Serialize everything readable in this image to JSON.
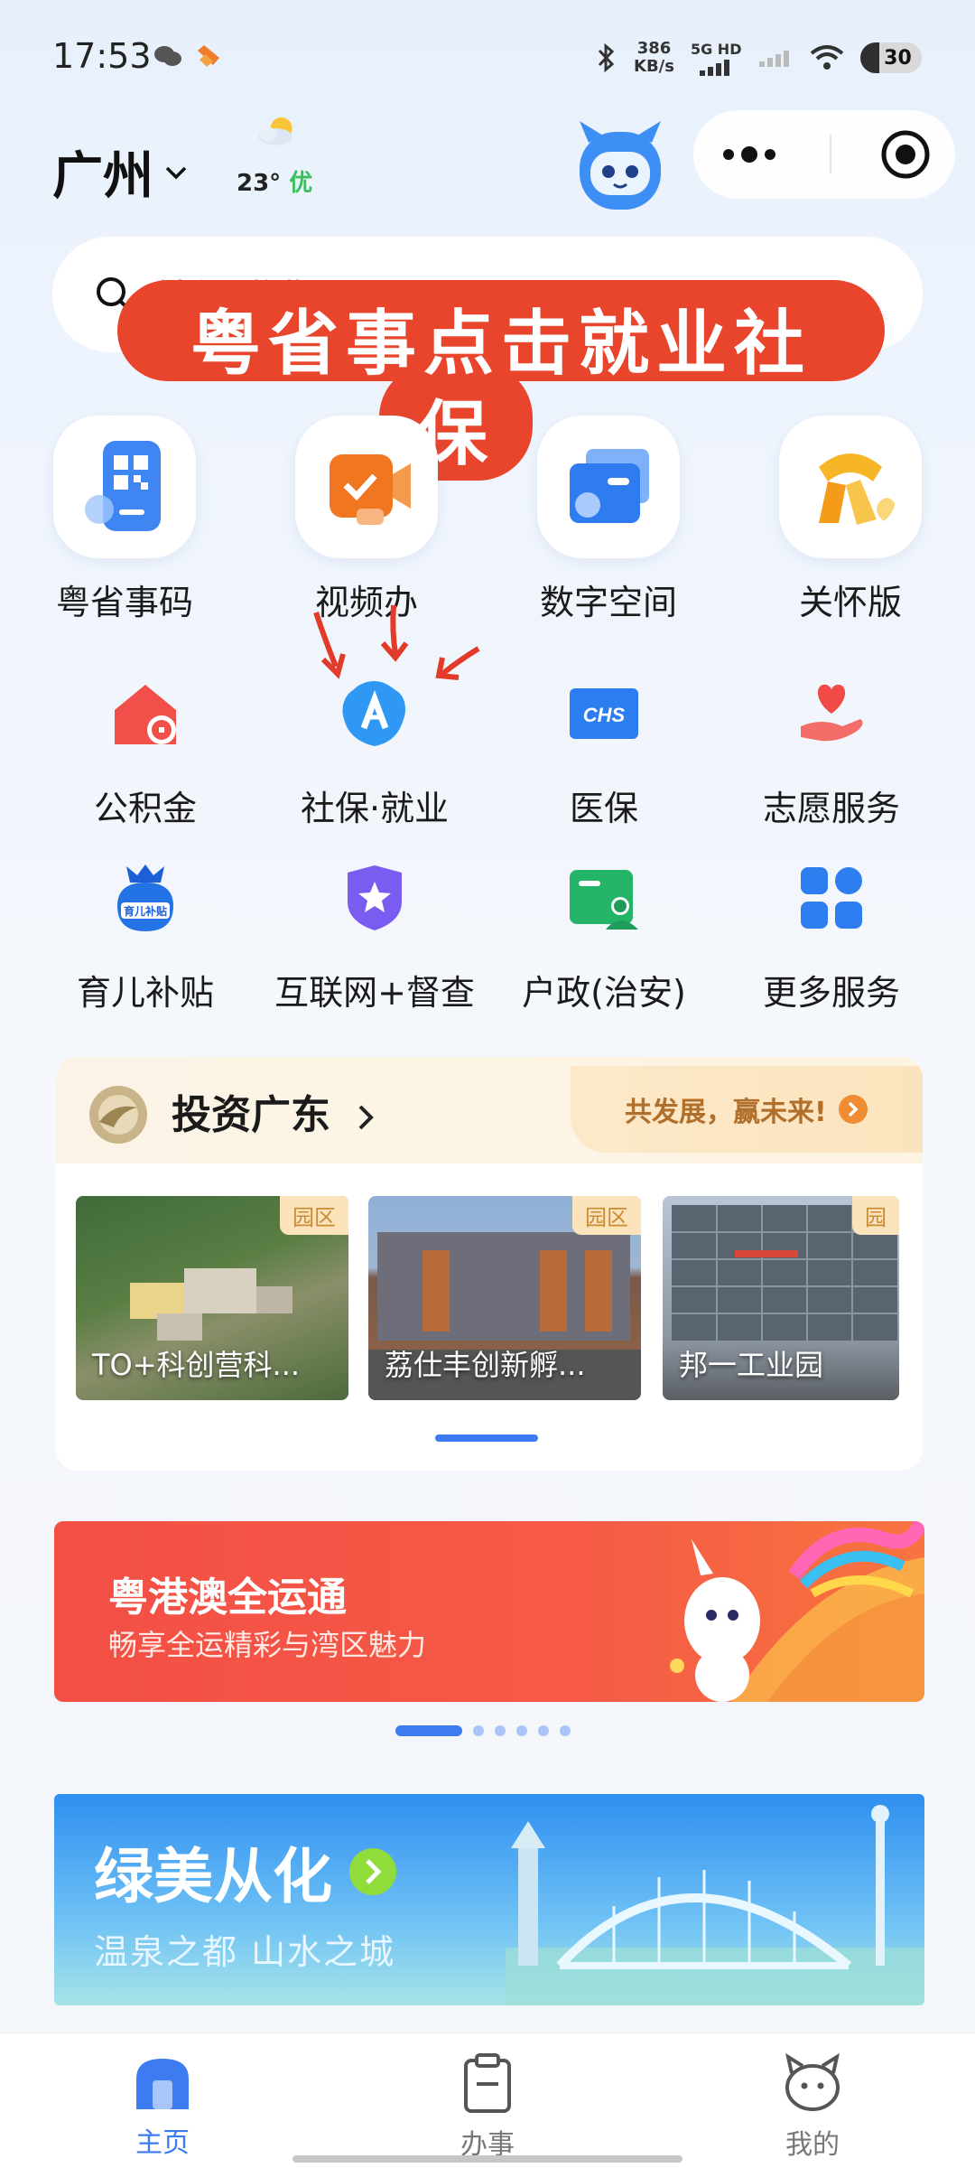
{
  "status_bar": {
    "time": "17:53",
    "net_speed_value": "386",
    "net_speed_unit": "KB/s",
    "network": "5G HD",
    "battery": "30"
  },
  "header": {
    "city": "广州",
    "temperature": "23°",
    "air_quality": "优"
  },
  "search": {
    "placeholder": "社保 缴费 ..."
  },
  "overlay_caption": {
    "line1": "粤省事点击就业社",
    "line2": "保"
  },
  "quick_apps": [
    {
      "label": "粤省事码",
      "icon": "qr-code-icon"
    },
    {
      "label": "视频办",
      "icon": "video-call-icon"
    },
    {
      "label": "数字空间",
      "icon": "folder-icon"
    },
    {
      "label": "关怀版",
      "icon": "scarf-icon"
    }
  ],
  "services": [
    {
      "label": "公积金",
      "icon": "house-fund-icon"
    },
    {
      "label": "社保·就业",
      "icon": "social-security-icon"
    },
    {
      "label": "医保",
      "icon": "chs-medical-icon"
    },
    {
      "label": "志愿服务",
      "icon": "heart-hand-icon"
    },
    {
      "label": "育儿补贴",
      "icon": "childcare-subsidy-icon",
      "badge": "育儿补贴"
    },
    {
      "label": "互联网+督查",
      "icon": "shield-star-icon"
    },
    {
      "label": "户政(治安)",
      "icon": "id-card-icon"
    },
    {
      "label": "更多服务",
      "icon": "grid-icon"
    }
  ],
  "invest": {
    "title": "投资广东",
    "slogan": "共发展，赢未来!",
    "parks": [
      {
        "tag": "园区",
        "name": "TO+科创营科..."
      },
      {
        "tag": "园区",
        "name": "荔仕丰创新孵..."
      },
      {
        "tag": "园",
        "name": "邦一工业园"
      }
    ]
  },
  "sports_banner": {
    "title": "粤港澳全运通",
    "subtitle": "畅享全运精彩与湾区魅力"
  },
  "city_banner": {
    "title": "绿美从化",
    "subtitle": "温泉之都 山水之城"
  },
  "bottom_nav": [
    {
      "label": "主页",
      "icon": "home-icon",
      "active": true
    },
    {
      "label": "办事",
      "icon": "clipboard-icon",
      "active": false
    },
    {
      "label": "我的",
      "icon": "profile-icon",
      "active": false
    }
  ],
  "colors": {
    "accent": "#3d7bf0",
    "overlay": "#e8452c",
    "banner_red": "#f24f45"
  }
}
